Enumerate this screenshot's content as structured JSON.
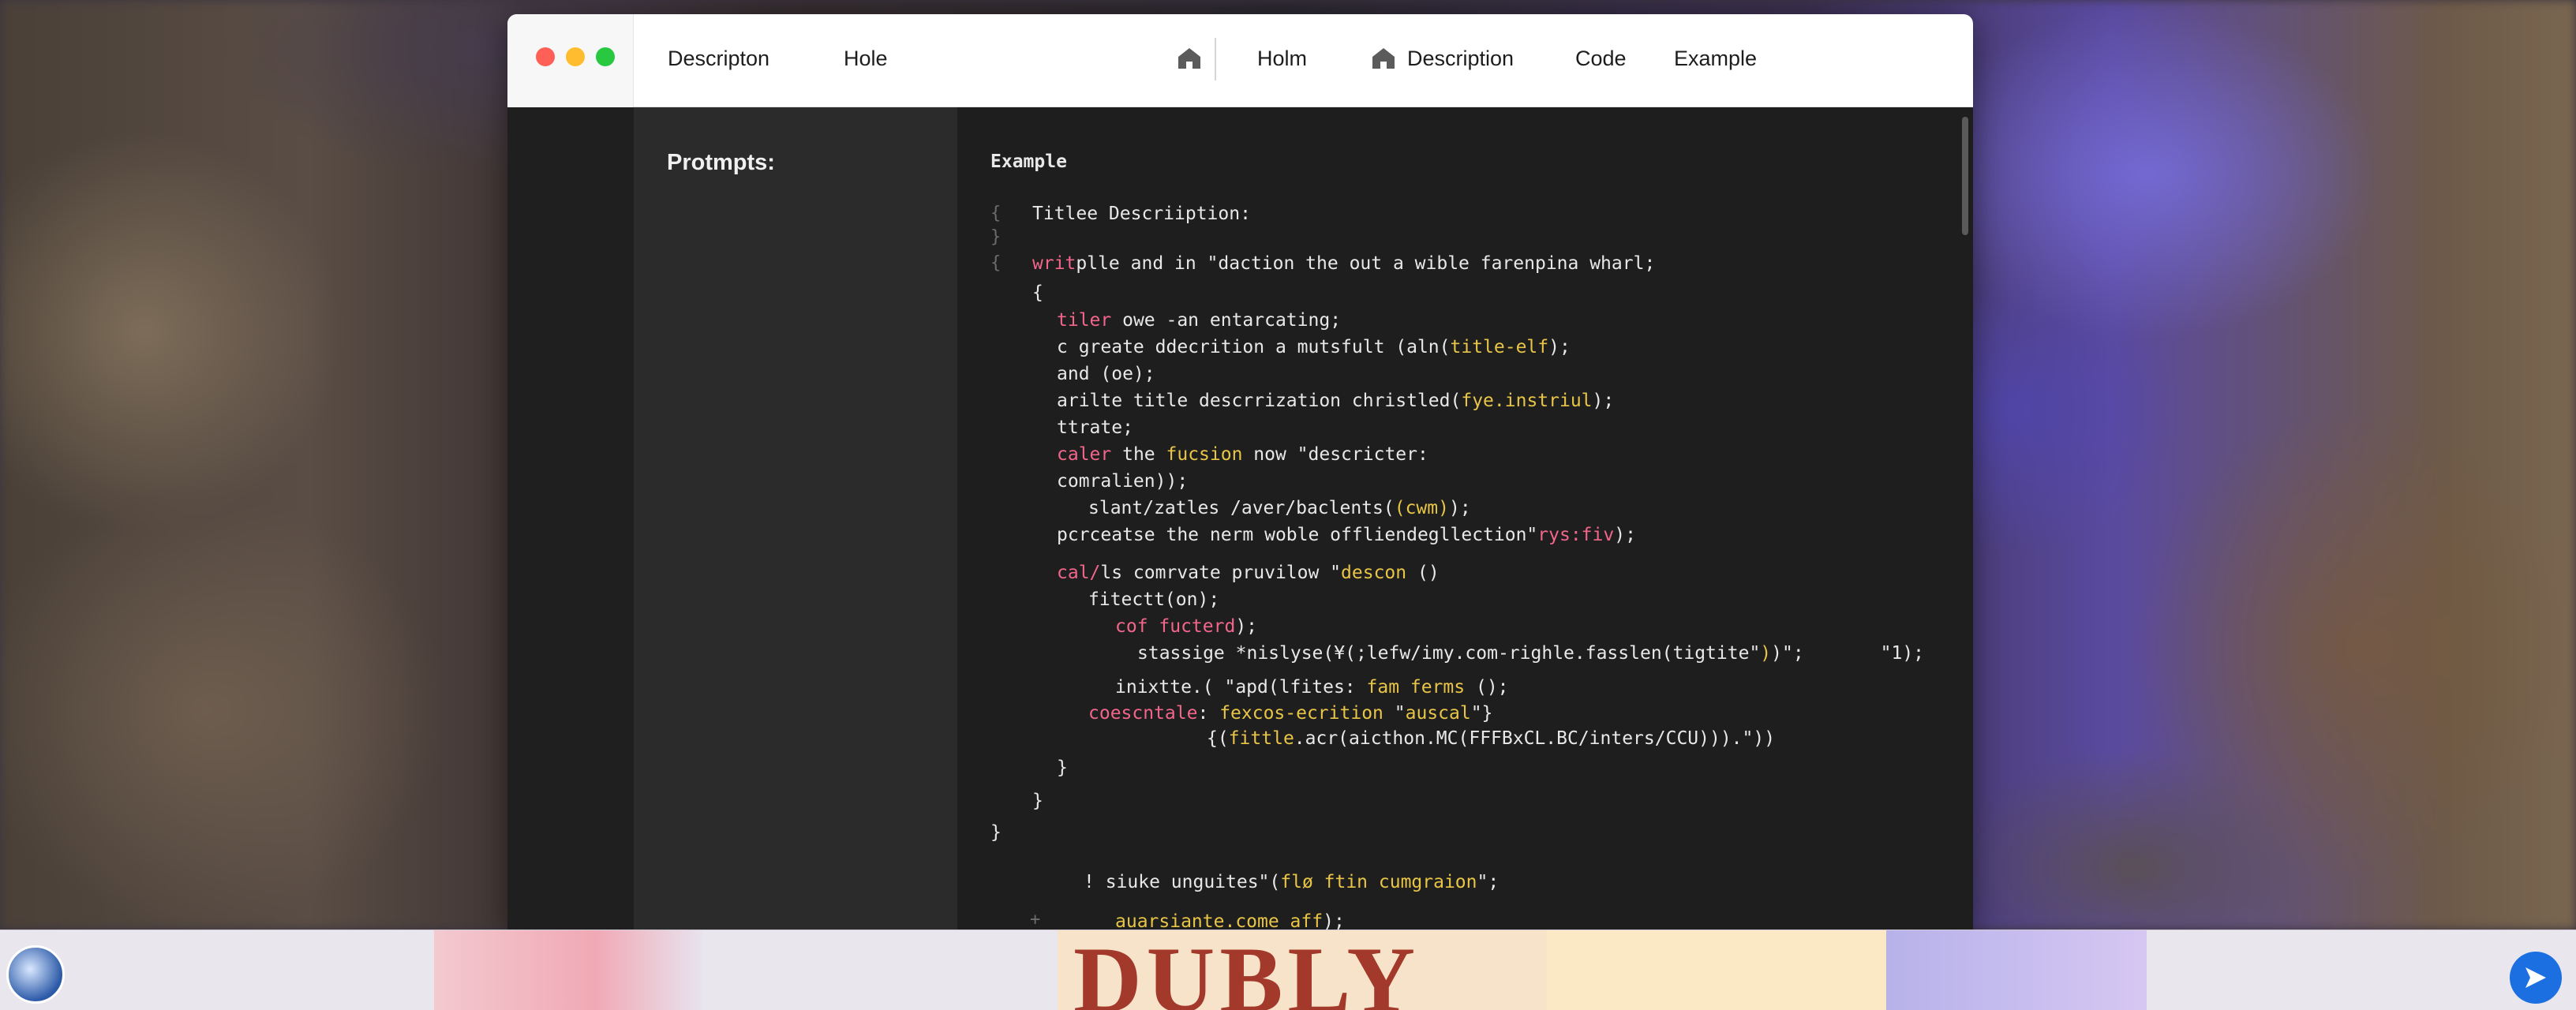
{
  "window": {
    "nav_left": [
      "Descripton",
      "Hole"
    ],
    "nav_right": [
      "Holm",
      "Description",
      "Code",
      "Example"
    ]
  },
  "sidebar": {
    "title": "Protmpts:"
  },
  "editor": {
    "heading": "Example",
    "gutter": [
      "{",
      "}",
      "{",
      "+"
    ],
    "lines": [
      {
        "segments": [
          {
            "t": "Titlee Descriiption:"
          }
        ]
      },
      {
        "segments": [
          {
            "t": "writ",
            "c": "pink"
          },
          {
            "t": "plle and in \"daction the out a wible farenpina wharl;"
          }
        ]
      },
      {
        "segments": [
          {
            "t": "{"
          }
        ]
      },
      {
        "segments": [
          {
            "t": "tiler",
            "c": "pink"
          },
          {
            "t": " owe -an entarcating;"
          }
        ]
      },
      {
        "segments": [
          {
            "t": "c greate ddecrition a mutsfult (aln("
          },
          {
            "t": "title-elf",
            "c": "yel"
          },
          {
            "t": ");"
          }
        ]
      },
      {
        "segments": [
          {
            "t": "and (oe);"
          }
        ]
      },
      {
        "segments": [
          {
            "t": "arilte title descrrization christled("
          },
          {
            "t": "fye.instriul",
            "c": "yel"
          },
          {
            "t": ");"
          }
        ]
      },
      {
        "segments": [
          {
            "t": "ttrate;"
          }
        ]
      },
      {
        "segments": [
          {
            "t": "caler",
            "c": "pink"
          },
          {
            "t": " the "
          },
          {
            "t": "fucsion",
            "c": "yel"
          },
          {
            "t": " now \"descricter:"
          }
        ]
      },
      {
        "segments": [
          {
            "t": "comralien));"
          }
        ]
      },
      {
        "segments": [
          {
            "t": "slant/zatles /aver/baclents("
          },
          {
            "t": "(cwm)",
            "c": "yel"
          },
          {
            "t": ");"
          }
        ]
      },
      {
        "segments": [
          {
            "t": "pcrceatse the nerm woble offliendegllection\""
          },
          {
            "t": "rys:fiv",
            "c": "pink"
          },
          {
            "t": ");"
          }
        ]
      },
      {
        "segments": [
          {
            "t": "cal/",
            "c": "pink"
          },
          {
            "t": "ls comrvate pruvilow \""
          },
          {
            "t": "descon",
            "c": "yel"
          },
          {
            "t": " ()"
          }
        ]
      },
      {
        "segments": [
          {
            "t": "fitectt(on);"
          }
        ]
      },
      {
        "segments": [
          {
            "t": "cof fucterd",
            "c": "pink"
          },
          {
            "t": ");"
          }
        ]
      },
      {
        "segments": [
          {
            "t": "stassige *nislyse(¥(;lefw/imy.com-righle.fasslen(tigtite\""
          },
          {
            "t": ")",
            "c": "yel"
          },
          {
            "t": ")\";       \"1);"
          }
        ]
      },
      {
        "segments": [
          {
            "t": "inixtte.( \"apd(lfites: "
          },
          {
            "t": "fam ferms",
            "c": "yel"
          },
          {
            "t": " ();"
          }
        ]
      },
      {
        "segments": [
          {
            "t": "coescntale",
            "c": "pink"
          },
          {
            "t": ": "
          },
          {
            "t": "fexcos-ecrition",
            "c": "yel"
          },
          {
            "t": " \""
          },
          {
            "t": "auscal",
            "c": "yel"
          },
          {
            "t": "\"}"
          }
        ]
      },
      {
        "segments": [
          {
            "t": "{("
          },
          {
            "t": "fittle",
            "c": "yel"
          },
          {
            "t": ".acr(aicthon.MC(FFFBxCL.BC/inters/CCU)))."
          },
          {
            "t": "\"))"
          }
        ]
      },
      {
        "segments": [
          {
            "t": "}"
          }
        ]
      },
      {
        "segments": [
          {
            "t": "}"
          }
        ]
      },
      {
        "segments": [
          {
            "t": "}"
          }
        ]
      },
      {
        "segments": [
          {
            "t": "! siuke unguites\"("
          },
          {
            "t": "flø ftin cumgraion",
            "c": "yel"
          },
          {
            "t": "\";"
          }
        ]
      },
      {
        "segments": [
          {
            "t": "auarsiante.come aff",
            "c": "yel"
          },
          {
            "t": ");"
          }
        ]
      }
    ]
  },
  "background": {
    "banner_text": "DUBLY"
  }
}
